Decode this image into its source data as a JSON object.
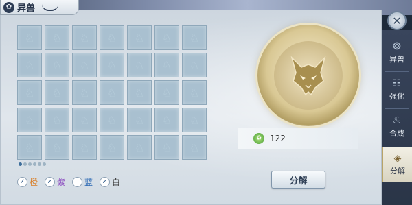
{
  "title": "异兽",
  "title_icon": "beast-emblem-icon",
  "sidebar": {
    "items": [
      {
        "label": "异兽",
        "icon": "beast-icon"
      },
      {
        "label": "强化",
        "icon": "enhance-icon"
      },
      {
        "label": "合成",
        "icon": "compose-icon"
      },
      {
        "label": "分解",
        "icon": "decompose-icon"
      }
    ],
    "active_index": 3
  },
  "grid": {
    "rows": 5,
    "cols": 7,
    "slot_icon": "empty-slot-icon"
  },
  "pagination": {
    "pages": 6,
    "current": 1
  },
  "filters": [
    {
      "label": "橙",
      "checked": true,
      "color": "#d9802a"
    },
    {
      "label": "紫",
      "checked": true,
      "color": "#8d4fc1"
    },
    {
      "label": "蓝",
      "checked": false,
      "color": "#2f6bb5"
    },
    {
      "label": "白",
      "checked": true,
      "color": "#333333"
    }
  ],
  "reward": {
    "icon": "green-essence-icon",
    "value": "122"
  },
  "action_button": "分解",
  "close_icon": "close-icon"
}
